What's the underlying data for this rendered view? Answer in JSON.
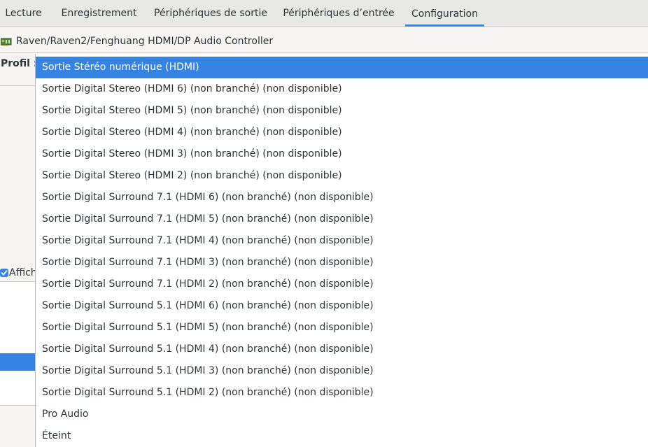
{
  "tabs": [
    {
      "label": "Lecture"
    },
    {
      "label": "Enregistrement"
    },
    {
      "label": "Périphériques de sortie"
    },
    {
      "label": "Périphériques d’entrée"
    },
    {
      "label": "Configuration",
      "active": true
    }
  ],
  "device": {
    "name": "Raven/Raven2/Fenghuang HDMI/DP Audio Controller",
    "icon": "sound-card-icon"
  },
  "profile": {
    "label": "Profil :",
    "selected": "Sortie Stéréo numérique (HDMI)",
    "options": [
      "Sortie Stéréo numérique (HDMI)",
      "Sortie Digital Stereo (HDMI 6) (non branché) (non disponible)",
      "Sortie Digital Stereo (HDMI 5) (non branché) (non disponible)",
      "Sortie Digital Stereo (HDMI 4) (non branché) (non disponible)",
      "Sortie Digital Stereo (HDMI 3) (non branché) (non disponible)",
      "Sortie Digital Stereo (HDMI 2) (non branché) (non disponible)",
      "Sortie Digital Surround 7.1 (HDMI 6) (non branché) (non disponible)",
      "Sortie Digital Surround 7.1 (HDMI 5) (non branché) (non disponible)",
      "Sortie Digital Surround 7.1 (HDMI 4) (non branché) (non disponible)",
      "Sortie Digital Surround 7.1 (HDMI 3) (non branché) (non disponible)",
      "Sortie Digital Surround 7.1 (HDMI 2) (non branché) (non disponible)",
      "Sortie Digital Surround 5.1 (HDMI 6) (non branché) (non disponible)",
      "Sortie Digital Surround 5.1 (HDMI 5) (non branché) (non disponible)",
      "Sortie Digital Surround 5.1 (HDMI 4) (non branché) (non disponible)",
      "Sortie Digital Surround 5.1 (HDMI 3) (non branché) (non disponible)",
      "Sortie Digital Surround 5.1 (HDMI 2) (non branché) (non disponible)",
      "Pro Audio",
      "Éteint"
    ]
  },
  "show_checkbox": {
    "label": "Affich",
    "checked": true
  },
  "colors": {
    "accent": "#3584e4",
    "background": "#f6f5f4",
    "text": "#2e3436"
  }
}
